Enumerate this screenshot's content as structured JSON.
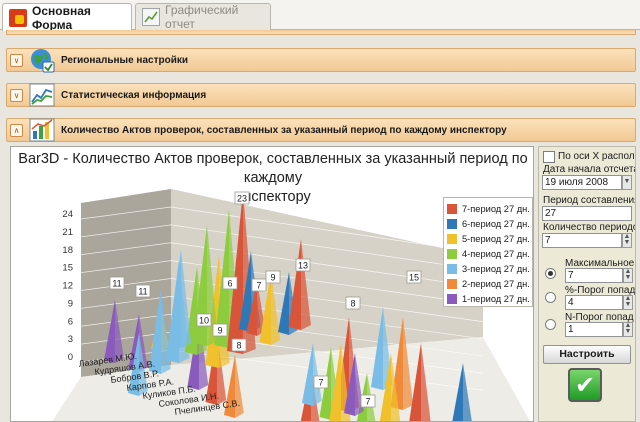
{
  "tabs": [
    {
      "label": "Основная Форма",
      "icon": "main-form-icon",
      "active": true
    },
    {
      "label": "Графический отчет",
      "icon": "chart-report-icon",
      "active": false
    }
  ],
  "sections": [
    {
      "title": "Региональные настройки",
      "icon": "globe-icon"
    },
    {
      "title": "Статистическая информация",
      "icon": "line-chart-icon"
    },
    {
      "title": "Количество Актов проверок, составленных за указанный период по каждому инспектору",
      "icon": "bar-chart-icon"
    }
  ],
  "chart_data": {
    "type": "bar",
    "subtype": "3d-pyramid",
    "title_line1": "Bar3D - Количество Актов проверок, составленных за указанный период по каждому",
    "title_line2": "инспектору",
    "y_ticks": [
      "24",
      "21",
      "18",
      "15",
      "12",
      "9",
      "6",
      "3",
      "0"
    ],
    "ylim": [
      0,
      24
    ],
    "categories": [
      "Лазарев М.Ю.",
      "Кудряшов А.В.",
      "Бобров В.Р.",
      "Карпов Р.А.",
      "Куликов П.Б.",
      "Соколова И.Н.",
      "Пчелинцев С.В."
    ],
    "legend_position": "right",
    "legend": [
      {
        "label": "7-период 27 дн.",
        "color": "#d9553a"
      },
      {
        "label": "6-период 27 дн.",
        "color": "#2f78b8"
      },
      {
        "label": "5-период 27 дн.",
        "color": "#f0c12c"
      },
      {
        "label": "4-период 27 дн.",
        "color": "#8ecc3f"
      },
      {
        "label": "3-период 27 дн.",
        "color": "#79bde6"
      },
      {
        "label": "2-период 27 дн.",
        "color": "#f08a3a"
      },
      {
        "label": "1-период 27 дн.",
        "color": "#8a5bbd"
      }
    ],
    "data_labels": [
      "11",
      "11",
      "10",
      "9",
      "8",
      "6",
      "23",
      "7",
      "9",
      "13",
      "8",
      "15",
      "7",
      "7"
    ]
  },
  "options": {
    "axis_check_label": "По оси X располо",
    "date_label": "Дата начала отсчета",
    "date_value": "19 июля 2008",
    "period_label": "Период составления",
    "period_value": "27",
    "count_label": "Количество периодов",
    "count_value": "7",
    "max_label": "Максимальное к",
    "max_value": "7",
    "pct_label": "%-Порог попад",
    "pct_value": "4",
    "n_label": "N-Порог попад",
    "n_value": "1",
    "configure_label": "Настроить"
  }
}
